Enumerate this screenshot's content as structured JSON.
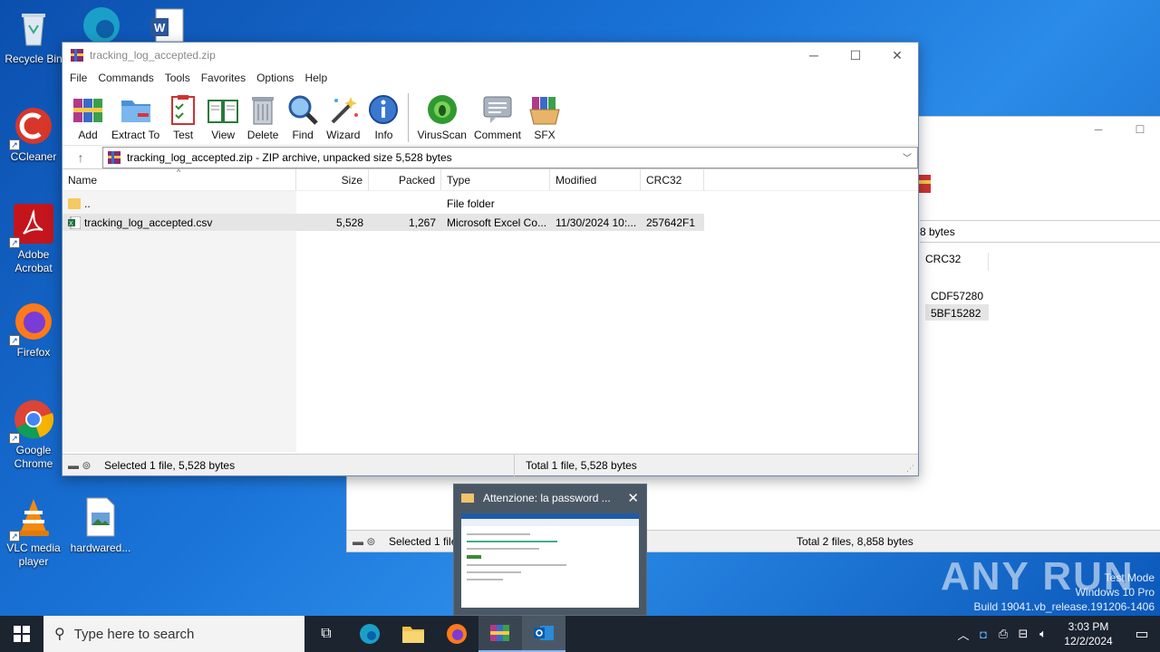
{
  "desktop": {
    "icons": [
      {
        "label": "Recycle Bin"
      },
      {
        "label": "CCleaner"
      },
      {
        "label": "Adobe Acrobat"
      },
      {
        "label": "Firefox"
      },
      {
        "label": "Google Chrome"
      },
      {
        "label": "VLC media player"
      },
      {
        "label": "hardwared..."
      }
    ]
  },
  "main_window": {
    "title": "tracking_log_accepted.zip",
    "menu": [
      "File",
      "Commands",
      "Tools",
      "Favorites",
      "Options",
      "Help"
    ],
    "toolbar": [
      "Add",
      "Extract To",
      "Test",
      "View",
      "Delete",
      "Find",
      "Wizard",
      "Info",
      "VirusScan",
      "Comment",
      "SFX"
    ],
    "address": "tracking_log_accepted.zip - ZIP archive, unpacked size 5,528 bytes",
    "columns": [
      "Name",
      "Size",
      "Packed",
      "Type",
      "Modified",
      "CRC32"
    ],
    "rows": [
      {
        "name": "..",
        "size": "",
        "packed": "",
        "type": "File folder",
        "modified": "",
        "crc": ""
      },
      {
        "name": "tracking_log_accepted.csv",
        "size": "5,528",
        "packed": "1,267",
        "type": "Microsoft Excel Co...",
        "modified": "11/30/2024 10:...",
        "crc": "257642F1"
      }
    ],
    "status_left": "Selected 1 file, 5,528 bytes",
    "status_right": "Total 1 file, 5,528 bytes"
  },
  "back_window": {
    "addr_fragment": "8 bytes",
    "col_crc": "CRC32",
    "crc1": "CDF57280",
    "crc2": "5BF15282",
    "status_left": "Selected 1 file",
    "status_right": "Total 2 files, 8,858 bytes"
  },
  "popup": {
    "title": "Attenzione: la password ..."
  },
  "watermark": {
    "brand": "ANY RUN",
    "line1": "Test Mode",
    "line2": "Windows 10 Pro",
    "line3": "Build 19041.vb_release.191206-1406"
  },
  "taskbar": {
    "search_placeholder": "Type here to search",
    "time": "3:03 PM",
    "date": "12/2/2024"
  },
  "colors": {
    "accent": "#0078d7",
    "selected_row": "#e5e5e5"
  }
}
